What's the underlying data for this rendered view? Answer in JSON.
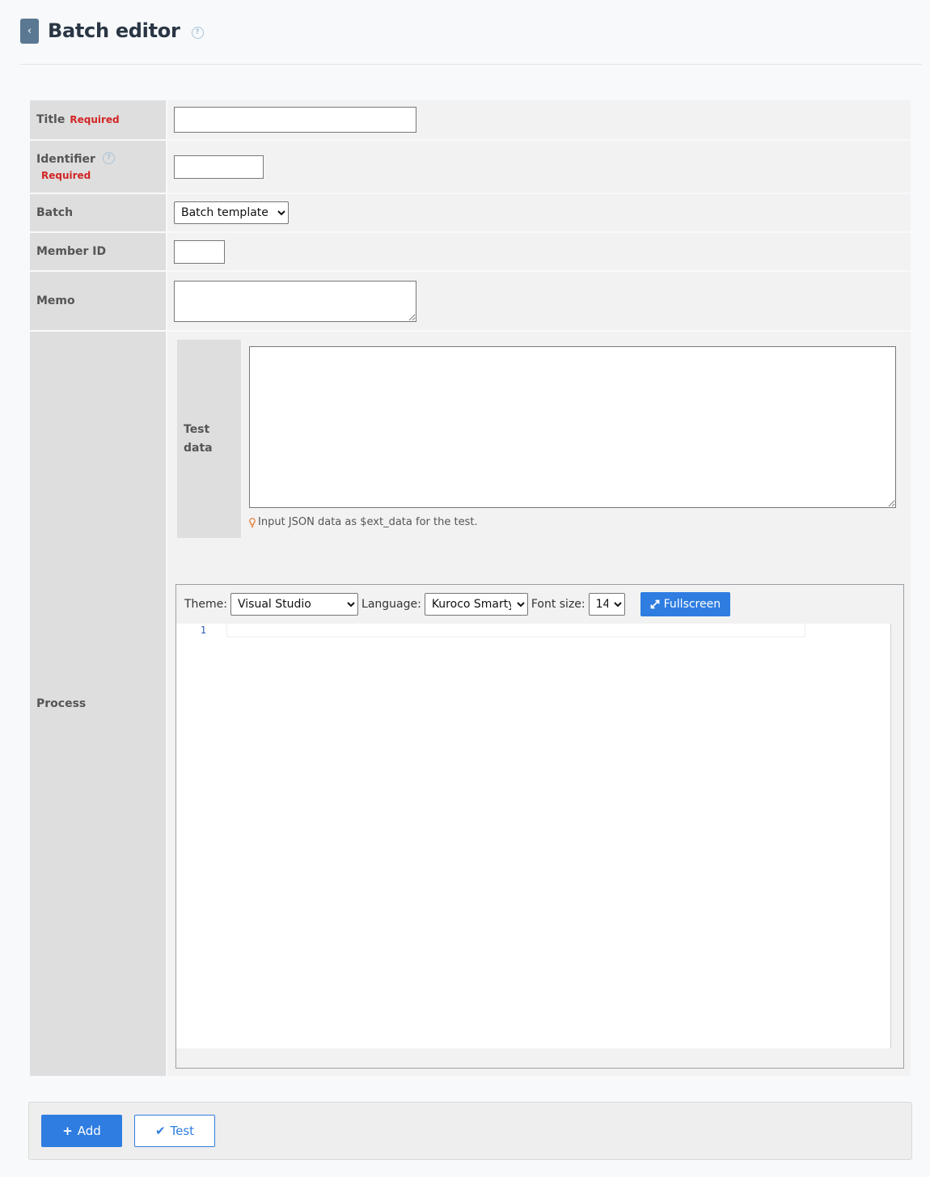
{
  "header": {
    "title": "Batch editor",
    "back_icon": "chevron-left-icon",
    "help_icon": "question-circle-icon",
    "back_glyph": "‹",
    "help_glyph": "?"
  },
  "form": {
    "required_label": "Required",
    "title": {
      "label": "Title",
      "value": ""
    },
    "identifier": {
      "label": "Identifier",
      "value": ""
    },
    "batch": {
      "label": "Batch",
      "options": [
        "Batch template"
      ],
      "selected": "Batch template"
    },
    "member_id": {
      "label": "Member ID",
      "value": ""
    },
    "memo": {
      "label": "Memo",
      "value": ""
    },
    "process": {
      "label": "Process",
      "test_data": {
        "label_line1": "Test",
        "label_line2": "data",
        "value": "",
        "hint": "Input JSON data as $ext_data for the test."
      },
      "editor": {
        "theme_label": "Theme:",
        "theme_options": [
          "Visual Studio"
        ],
        "theme_selected": "Visual Studio",
        "language_label": "Language:",
        "language_options": [
          "Kuroco Smarty"
        ],
        "language_selected": "Kuroco Smarty",
        "font_size_label": "Font size:",
        "font_size_options": [
          "14"
        ],
        "font_size_selected": "14",
        "fullscreen_label": "Fullscreen",
        "line_numbers": [
          "1"
        ]
      }
    }
  },
  "footer": {
    "add_label": "Add",
    "add_icon_glyph": "+",
    "test_label": "Test",
    "test_icon_glyph": "✔"
  },
  "colors": {
    "primary": "#2f7de1",
    "required": "#d22525",
    "back_button": "#5a7892"
  }
}
